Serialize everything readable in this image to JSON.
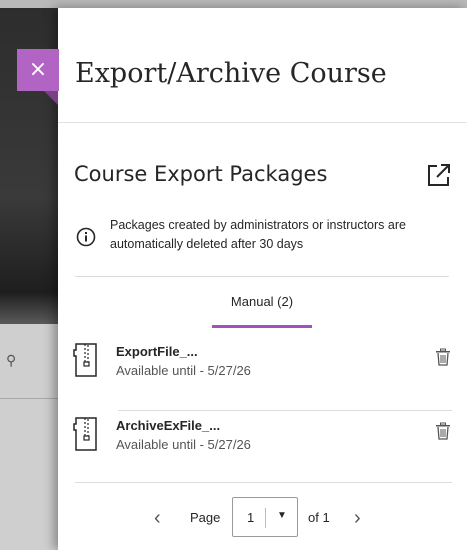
{
  "panel": {
    "title": "Export/Archive Course",
    "close_label": "×"
  },
  "section": {
    "title": "Course Export Packages",
    "info": "Packages created by administrators or instructors are automatically deleted after 30 days"
  },
  "tabs": [
    {
      "label": "Manual (2)",
      "active": true
    }
  ],
  "packages": [
    {
      "name": "ExportFile_...",
      "available": "Available until - 5/27/26"
    },
    {
      "name": "ArchiveExFile_...",
      "available": "Available until - 5/27/26"
    }
  ],
  "pager": {
    "prev": "‹",
    "page_label": "Page",
    "current": "1",
    "caret": "▼",
    "of_label": "of 1",
    "next": "›"
  },
  "colors": {
    "accent": "#b164c4",
    "tab_underline": "#a152bf",
    "text": "#262626"
  }
}
